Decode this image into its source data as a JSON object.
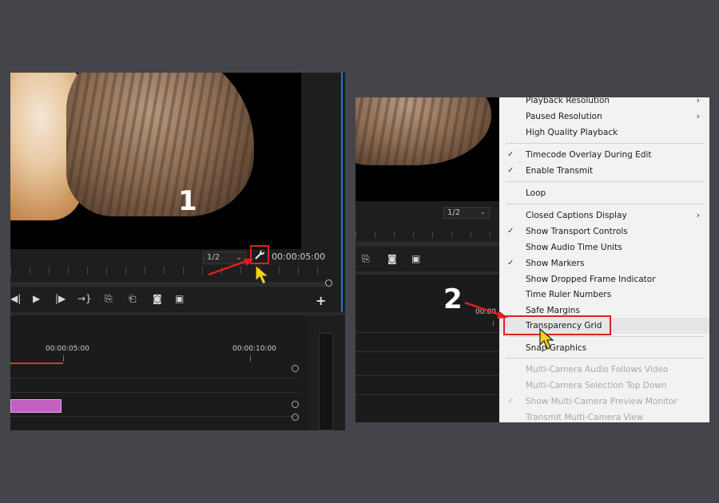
{
  "left": {
    "resolution": {
      "value": "1/2",
      "chevron": "⌄"
    },
    "timecode": "00:00:05:00",
    "step_label": "1",
    "timeline_times": [
      "00:00:05:00",
      "00:00:10:00"
    ],
    "plus_label": "+"
  },
  "right": {
    "resolution": {
      "value": "1/2",
      "chevron": "⌄"
    },
    "partial_time": "00:00",
    "step_label": "2"
  },
  "menu": {
    "items": [
      {
        "label": "Playback Resolution",
        "check": "",
        "sub": "›",
        "disabled": false
      },
      {
        "label": "Paused Resolution",
        "check": "",
        "sub": "›",
        "disabled": false
      },
      {
        "label": "High Quality Playback",
        "check": "",
        "sub": "",
        "disabled": false
      },
      {
        "label": "Timecode Overlay During Edit",
        "check": "✓",
        "sub": "",
        "disabled": false
      },
      {
        "label": "Enable Transmit",
        "check": "✓",
        "sub": "",
        "disabled": false
      },
      {
        "label": "Loop",
        "check": "",
        "sub": "",
        "disabled": false
      },
      {
        "label": "Closed Captions Display",
        "check": "",
        "sub": "›",
        "disabled": false
      },
      {
        "label": "Show Transport Controls",
        "check": "✓",
        "sub": "",
        "disabled": false
      },
      {
        "label": "Show Audio Time Units",
        "check": "",
        "sub": "",
        "disabled": false
      },
      {
        "label": "Show Markers",
        "check": "✓",
        "sub": "",
        "disabled": false
      },
      {
        "label": "Show Dropped Frame Indicator",
        "check": "",
        "sub": "",
        "disabled": false
      },
      {
        "label": "Time Ruler Numbers",
        "check": "",
        "sub": "",
        "disabled": false
      },
      {
        "label": "Safe Margins",
        "check": "",
        "sub": "",
        "disabled": false
      },
      {
        "label": "Transparency Grid",
        "check": "",
        "sub": "",
        "disabled": false
      },
      {
        "label": "Snap Graphics",
        "check": "",
        "sub": "",
        "disabled": false
      },
      {
        "label": "Multi-Camera Audio Follows Video",
        "check": "",
        "sub": "",
        "disabled": true
      },
      {
        "label": "Multi-Camera Selection Top Down",
        "check": "",
        "sub": "",
        "disabled": true
      },
      {
        "label": "Show Multi-Camera Preview Monitor",
        "check": "✓",
        "sub": "",
        "disabled": true
      },
      {
        "label": "Transmit Multi-Camera View",
        "check": "",
        "sub": "",
        "disabled": true
      }
    ]
  },
  "icons": {
    "wrench": "wrench-icon",
    "pointer": "cursor-pointer-icon"
  },
  "colors": {
    "highlight_red": "#e02020",
    "cursor_yellow": "#f2d21b",
    "clip_purple": "#c35fc0"
  }
}
